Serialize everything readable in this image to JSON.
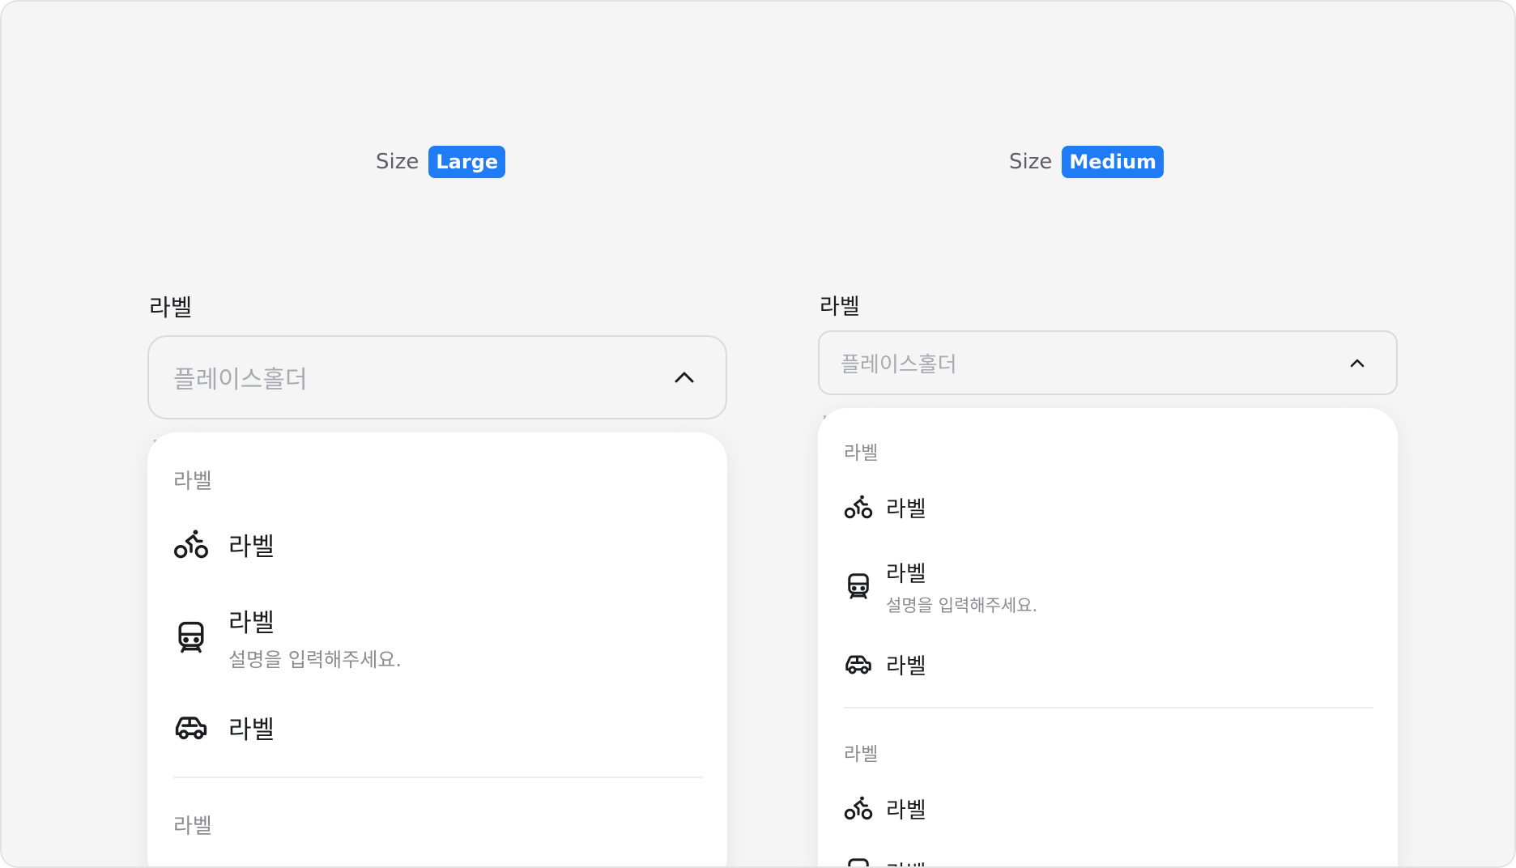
{
  "large": {
    "size_prefix": "Size",
    "size_value": "Large",
    "field_label": "라벨",
    "placeholder": "플레이스홀더",
    "menu": {
      "group1_label": "라벨",
      "items": [
        {
          "icon": "bicycle-icon",
          "label": "라벨"
        },
        {
          "icon": "train-icon",
          "label": "라벨",
          "description": "설명을 입력해주세요."
        },
        {
          "icon": "car-icon",
          "label": "라벨"
        }
      ],
      "group2_label": "라벨"
    }
  },
  "medium": {
    "size_prefix": "Size",
    "size_value": "Medium",
    "field_label": "라벨",
    "placeholder": "플레이스홀더",
    "menu": {
      "group1_label": "라벨",
      "items": [
        {
          "icon": "bicycle-icon",
          "label": "라벨"
        },
        {
          "icon": "train-icon",
          "label": "라벨",
          "description": "설명을 입력해주세요."
        },
        {
          "icon": "car-icon",
          "label": "라벨"
        }
      ],
      "group2_label": "라벨",
      "group2_items": [
        {
          "icon": "bicycle-icon",
          "label": "라벨"
        },
        {
          "icon": "train-icon",
          "label": "라벨"
        }
      ]
    }
  },
  "colors": {
    "accent": "#1f7cf5",
    "background": "#f5f5f6",
    "text_primary": "#1b1c1f",
    "text_secondary": "#8a8c92",
    "placeholder": "#a8aab0"
  }
}
